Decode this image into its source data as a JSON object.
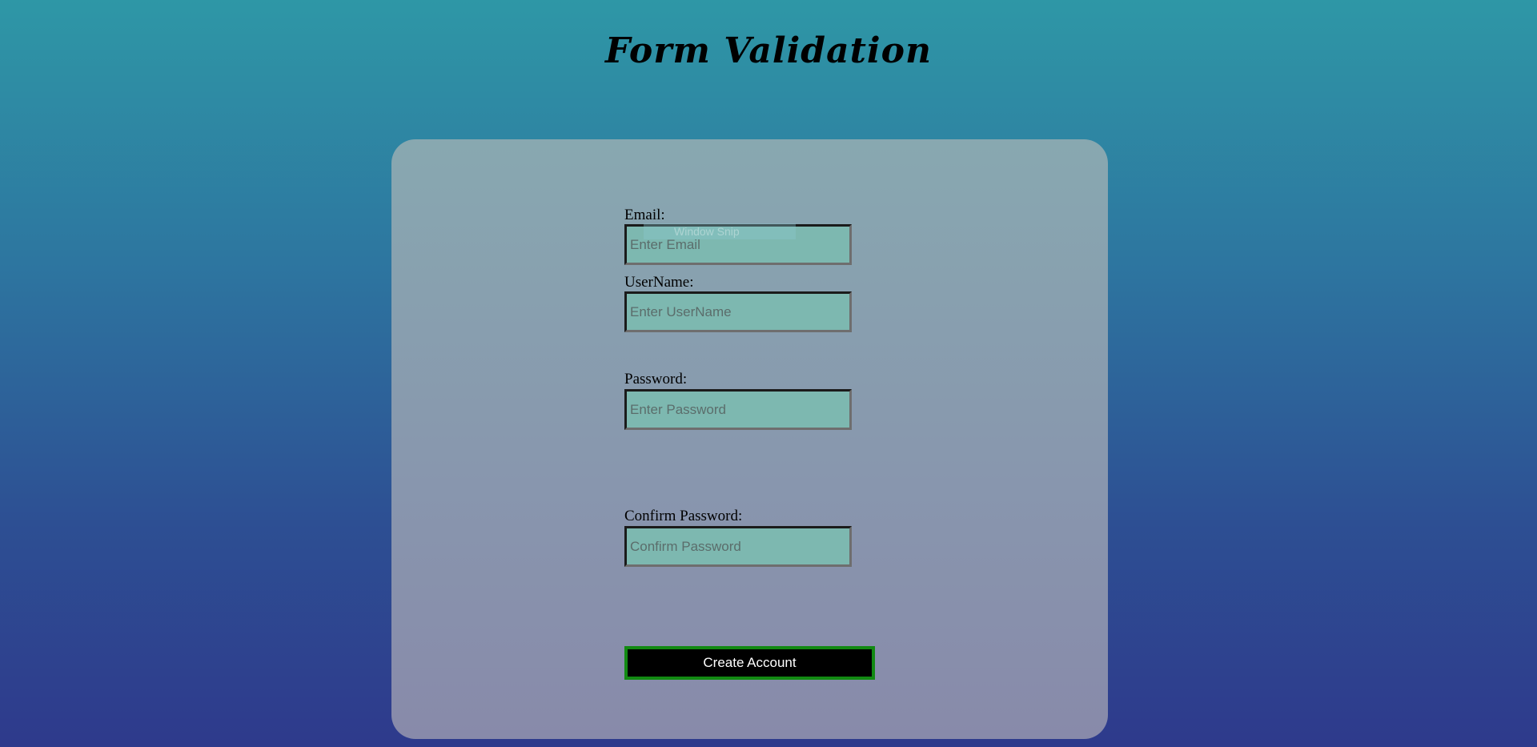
{
  "page": {
    "title": "Form Validation"
  },
  "form": {
    "email": {
      "label": "Email:",
      "placeholder": "Enter Email",
      "value": ""
    },
    "username": {
      "label": "UserName:",
      "placeholder": "Enter UserName",
      "value": ""
    },
    "password": {
      "label": "Password:",
      "placeholder": "Enter Password",
      "value": ""
    },
    "confirm_password": {
      "label": "Confirm Password:",
      "placeholder": "Confirm Password",
      "value": ""
    },
    "submit_label": "Create Account"
  },
  "overlay": {
    "ghost_tooltip": "Window Snip"
  },
  "colors": {
    "input_background": "#7db8b0",
    "button_background": "#000000",
    "button_border": "#128a12",
    "card_background": "#8897ae"
  }
}
